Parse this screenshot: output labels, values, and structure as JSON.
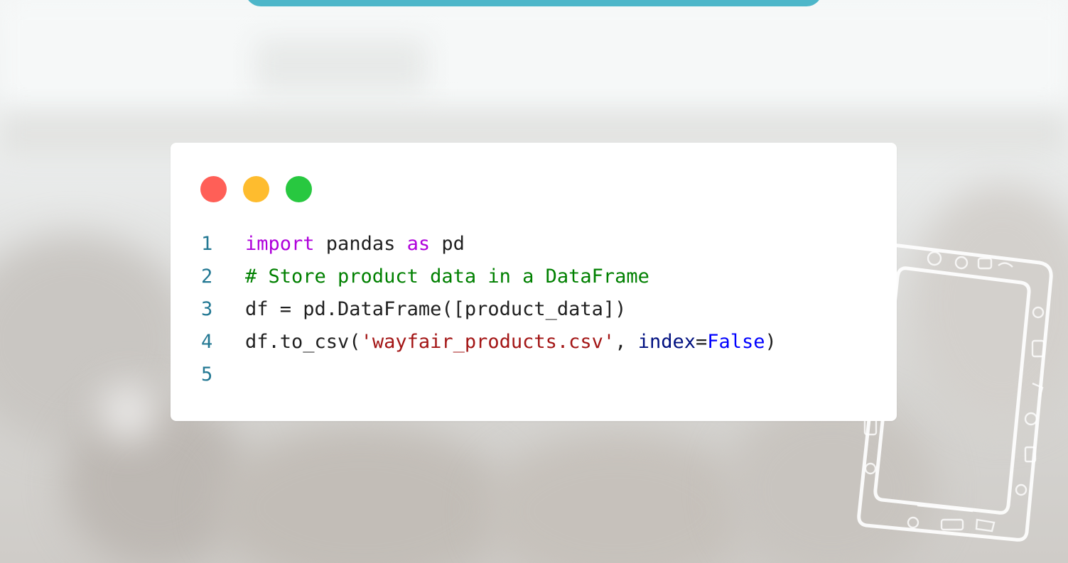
{
  "window_controls": {
    "close_color": "#ff5f57",
    "minimize_color": "#febc2e",
    "maximize_color": "#28c840"
  },
  "accent_color": "#4db6c9",
  "code": {
    "language": "python",
    "lines": [
      {
        "number": "1",
        "tokens": [
          {
            "type": "keyword",
            "text": "import"
          },
          {
            "type": "plain",
            "text": " pandas "
          },
          {
            "type": "keyword",
            "text": "as"
          },
          {
            "type": "plain",
            "text": " pd"
          }
        ]
      },
      {
        "number": "2",
        "tokens": [
          {
            "type": "comment",
            "text": "# Store product data in a DataFrame"
          }
        ]
      },
      {
        "number": "3",
        "tokens": [
          {
            "type": "plain",
            "text": "df = pd.DataFrame([product_data])"
          }
        ]
      },
      {
        "number": "4",
        "tokens": [
          {
            "type": "plain",
            "text": "df.to_csv("
          },
          {
            "type": "string",
            "text": "'wayfair_products.csv'"
          },
          {
            "type": "plain",
            "text": ", "
          },
          {
            "type": "param",
            "text": "index"
          },
          {
            "type": "plain",
            "text": "="
          },
          {
            "type": "constant",
            "text": "False"
          },
          {
            "type": "plain",
            "text": ")"
          }
        ]
      },
      {
        "number": "5",
        "tokens": []
      }
    ]
  },
  "decoration": {
    "icon": "phone-doodle-frame-icon"
  }
}
